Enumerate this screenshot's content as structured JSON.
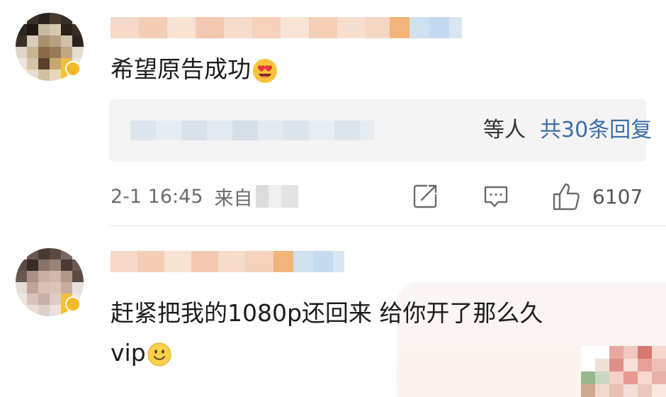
{
  "comments": [
    {
      "text": "希望原告成功",
      "emoji": "heart-eyes-emoji",
      "replies": {
        "suffix": "等人",
        "link": "共30条回复"
      },
      "meta": {
        "time": "2-1 16:45",
        "source_prefix": "来自"
      },
      "actions": {
        "share_icon": "share-icon",
        "comment_icon": "comment-icon",
        "like_icon": "thumbs-up-icon",
        "like_count": "6107"
      }
    },
    {
      "text_line1": "赶紧把我的1080p还回来 给你开了那么久",
      "text_line2": "vip",
      "emoji": "smiley-emoji"
    }
  ],
  "colors": {
    "link": "#3a6ea8",
    "meta": "#6b6b6b",
    "reply_bg": "#f4f4f4"
  }
}
